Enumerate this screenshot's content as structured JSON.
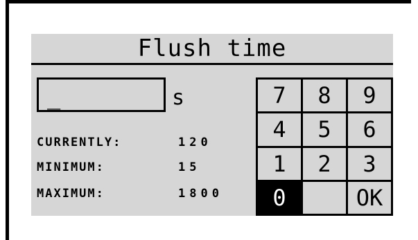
{
  "dialog": {
    "title": "Flush time",
    "input_value": "_",
    "unit": "s"
  },
  "info": [
    {
      "label": "CURRENTLY:",
      "value": "120"
    },
    {
      "label": "MINIMUM:",
      "value": "15"
    },
    {
      "label": "MAXIMUM:",
      "value": "1800"
    }
  ],
  "keypad": {
    "keys": [
      "7",
      "8",
      "9",
      "4",
      "5",
      "6",
      "1",
      "2",
      "3",
      "0",
      "",
      "OK"
    ],
    "selected_key": "0"
  },
  "colors": {
    "screen_background": "#d6d6d6",
    "foreground": "#000000",
    "selected_key_background": "#000000",
    "selected_key_text": "#ffffff"
  }
}
